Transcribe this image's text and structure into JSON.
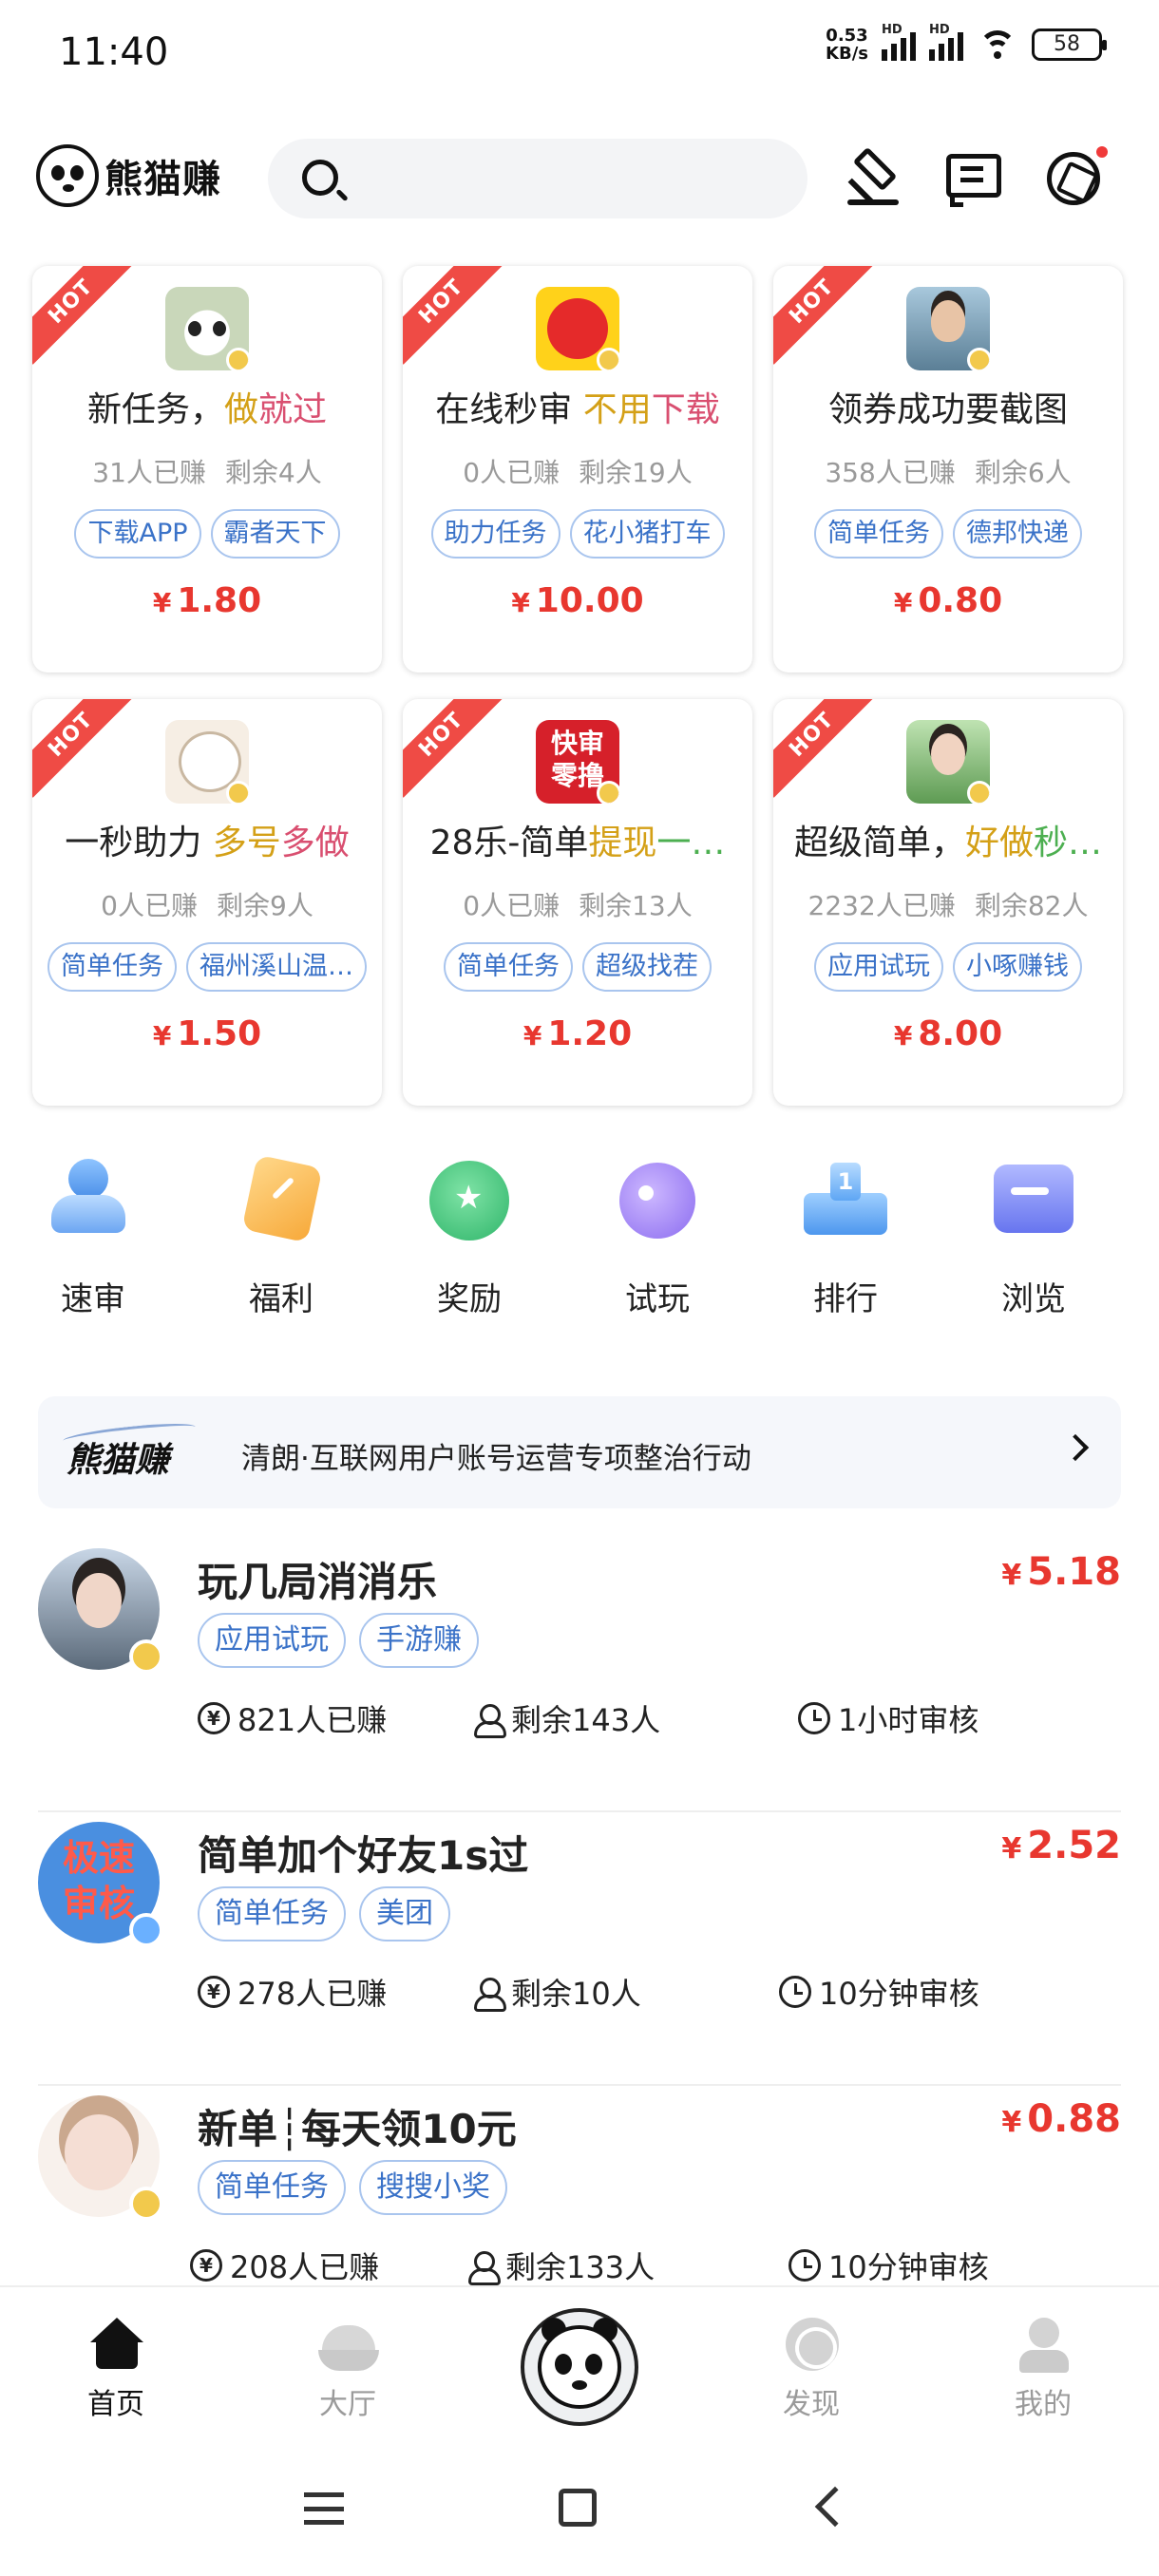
{
  "status_bar": {
    "time": "11:40",
    "net_speed_value": "0.53",
    "net_speed_unit": "KB/s",
    "hd1": "HD",
    "hd2": "HD",
    "battery": "58"
  },
  "header": {
    "brand": "熊猫赚",
    "search_placeholder": ""
  },
  "hot_label": "HOT",
  "currency": "¥",
  "hot_tasks": [
    {
      "title_plain": "新任务，",
      "title_highlight": [
        {
          "text": "做",
          "color": "#d4a017"
        },
        {
          "text": "就过",
          "color": "#d94f70"
        }
      ],
      "earned": "31人已赚",
      "remaining": "剩余4人",
      "tags": [
        "下载APP",
        "霸者天下"
      ],
      "price": "1.80",
      "avatar": "panda-avatar"
    },
    {
      "title_plain": "在线秒审 ",
      "title_highlight": [
        {
          "text": "不用",
          "color": "#d4a017"
        },
        {
          "text": "下载",
          "color": "#d94f70"
        }
      ],
      "earned": "0人已赚",
      "remaining": "剩余19人",
      "tags": [
        "助力任务",
        "花小猪打车"
      ],
      "price": "10.00",
      "avatar": "fast-review-badge-avatar"
    },
    {
      "title_plain": "领券成功要截图",
      "title_highlight": [],
      "earned": "358人已赚",
      "remaining": "剩余6人",
      "tags": [
        "简单任务",
        "德邦快递"
      ],
      "price": "0.80",
      "avatar": "man-photo-avatar"
    },
    {
      "title_plain": "一秒助力 ",
      "title_highlight": [
        {
          "text": "多号",
          "color": "#d4a017"
        },
        {
          "text": "多做",
          "color": "#d94f70"
        }
      ],
      "earned": "0人已赚",
      "remaining": "剩余9人",
      "tags": [
        "简单任务",
        "福州溪山温…"
      ],
      "price": "1.50",
      "avatar": "sheep-avatar"
    },
    {
      "title_plain": "28乐-简单",
      "title_highlight": [
        {
          "text": "提现",
          "color": "#d4a017"
        },
        {
          "text": "一…",
          "color": "#4caf50"
        }
      ],
      "earned": "0人已赚",
      "remaining": "剩余13人",
      "tags": [
        "简单任务",
        "超级找茬"
      ],
      "price": "1.20",
      "avatar": "quick-review-avatar",
      "avatar_text": "快审零撸"
    },
    {
      "title_plain": "超级简单，",
      "title_highlight": [
        {
          "text": "好做",
          "color": "#d4a017"
        },
        {
          "text": "秒…",
          "color": "#4caf50"
        }
      ],
      "earned": "2232人已赚",
      "remaining": "剩余82人",
      "tags": [
        "应用试玩",
        "小啄赚钱"
      ],
      "price": "8.00",
      "avatar": "girl-photo-avatar"
    }
  ],
  "categories": [
    {
      "label": "速审",
      "icon": "fast-review-icon"
    },
    {
      "label": "福利",
      "icon": "welfare-icon"
    },
    {
      "label": "奖励",
      "icon": "reward-icon"
    },
    {
      "label": "试玩",
      "icon": "trial-icon"
    },
    {
      "label": "排行",
      "icon": "ranking-icon"
    },
    {
      "label": "浏览",
      "icon": "browse-icon"
    }
  ],
  "notice": {
    "brand": "熊猫赚",
    "text": "清朗·互联网用户账号运营专项整治行动"
  },
  "tasks": [
    {
      "title": "玩几局消消乐",
      "price": "5.18",
      "tags": [
        "应用试玩",
        "手游赚"
      ],
      "earned": "821人已赚",
      "remaining": "剩余143人",
      "review": "1小时审核"
    },
    {
      "title": "简单加个好友1s过",
      "price": "2.52",
      "tags": [
        "简单任务",
        "美团"
      ],
      "earned": "278人已赚",
      "remaining": "剩余10人",
      "review": "10分钟审核",
      "avatar_text": "极速审核"
    },
    {
      "title": "新单┆每天领10元",
      "price": "0.88",
      "tags": [
        "简单任务",
        "搜搜小奖"
      ],
      "earned": "208人已赚",
      "remaining": "剩余133人",
      "review": "10分钟审核"
    }
  ],
  "bottom_nav": [
    {
      "label": "首页",
      "icon": "home-icon",
      "active": true
    },
    {
      "label": "大厅",
      "icon": "hall-icon",
      "active": false
    },
    {
      "label": "",
      "icon": "panda-center-icon",
      "active": false
    },
    {
      "label": "发现",
      "icon": "discover-icon",
      "active": false
    },
    {
      "label": "我的",
      "icon": "profile-icon",
      "active": false
    }
  ],
  "colors": {
    "price_red": "#e8372f",
    "hot_red": "#ef4b45",
    "tag_blue": "#3a72c8",
    "tag_border": "#a9c5ee"
  }
}
